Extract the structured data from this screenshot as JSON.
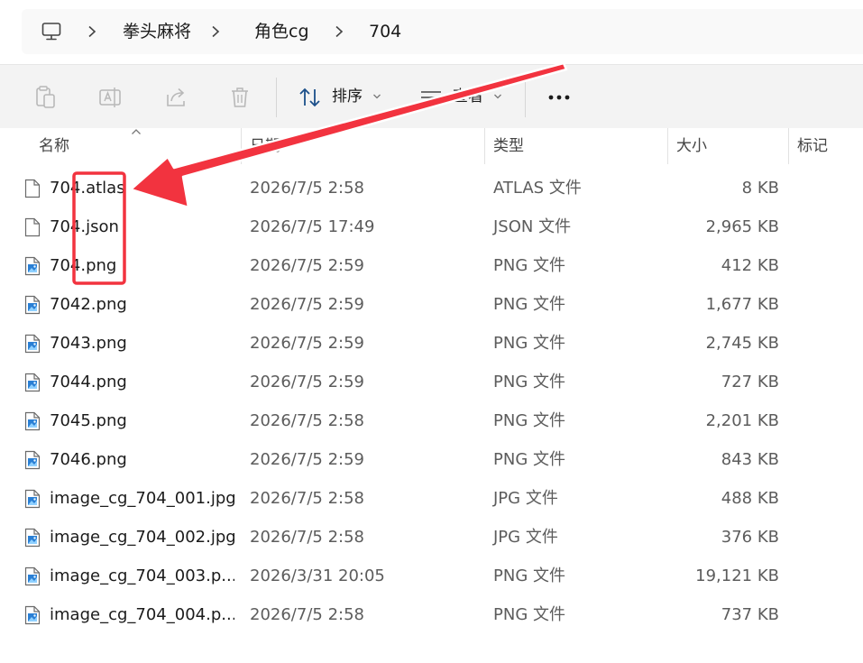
{
  "breadcrumb": {
    "items": [
      "拳头麻将",
      "角色cg",
      "704"
    ]
  },
  "toolbar": {
    "sort_label": "排序",
    "view_label": "查看"
  },
  "columns": {
    "name": "名称",
    "date": "日期",
    "type": "类型",
    "size": "大小",
    "tags": "标记"
  },
  "files": [
    {
      "name": "704.atlas",
      "date": "2026/7/5 2:58",
      "type": "ATLAS 文件",
      "size": "8 KB",
      "icon": "generic-file-icon"
    },
    {
      "name": "704.json",
      "date": "2026/7/5 17:49",
      "type": "JSON 文件",
      "size": "2,965 KB",
      "icon": "generic-file-icon"
    },
    {
      "name": "704.png",
      "date": "2026/7/5 2:59",
      "type": "PNG 文件",
      "size": "412 KB",
      "icon": "image-file-icon"
    },
    {
      "name": "7042.png",
      "date": "2026/7/5 2:59",
      "type": "PNG 文件",
      "size": "1,677 KB",
      "icon": "image-file-icon"
    },
    {
      "name": "7043.png",
      "date": "2026/7/5 2:59",
      "type": "PNG 文件",
      "size": "2,745 KB",
      "icon": "image-file-icon"
    },
    {
      "name": "7044.png",
      "date": "2026/7/5 2:59",
      "type": "PNG 文件",
      "size": "727 KB",
      "icon": "image-file-icon"
    },
    {
      "name": "7045.png",
      "date": "2026/7/5 2:58",
      "type": "PNG 文件",
      "size": "2,201 KB",
      "icon": "image-file-icon"
    },
    {
      "name": "7046.png",
      "date": "2026/7/5 2:59",
      "type": "PNG 文件",
      "size": "843 KB",
      "icon": "image-file-icon"
    },
    {
      "name": "image_cg_704_001.jpg",
      "date": "2026/7/5 2:58",
      "type": "JPG 文件",
      "size": "488 KB",
      "icon": "image-file-icon"
    },
    {
      "name": "image_cg_704_002.jpg",
      "date": "2026/7/5 2:58",
      "type": "JPG 文件",
      "size": "376 KB",
      "icon": "image-file-icon"
    },
    {
      "name": "image_cg_704_003.p...",
      "date": "2026/3/31 20:05",
      "type": "PNG 文件",
      "size": "19,121 KB",
      "icon": "image-file-icon"
    },
    {
      "name": "image_cg_704_004.p...",
      "date": "2026/7/5 2:58",
      "type": "PNG 文件",
      "size": "737 KB",
      "icon": "image-file-icon"
    }
  ],
  "colors": {
    "annotation_red": "#f2333f",
    "image_icon_blue": "#2a7fd4"
  }
}
